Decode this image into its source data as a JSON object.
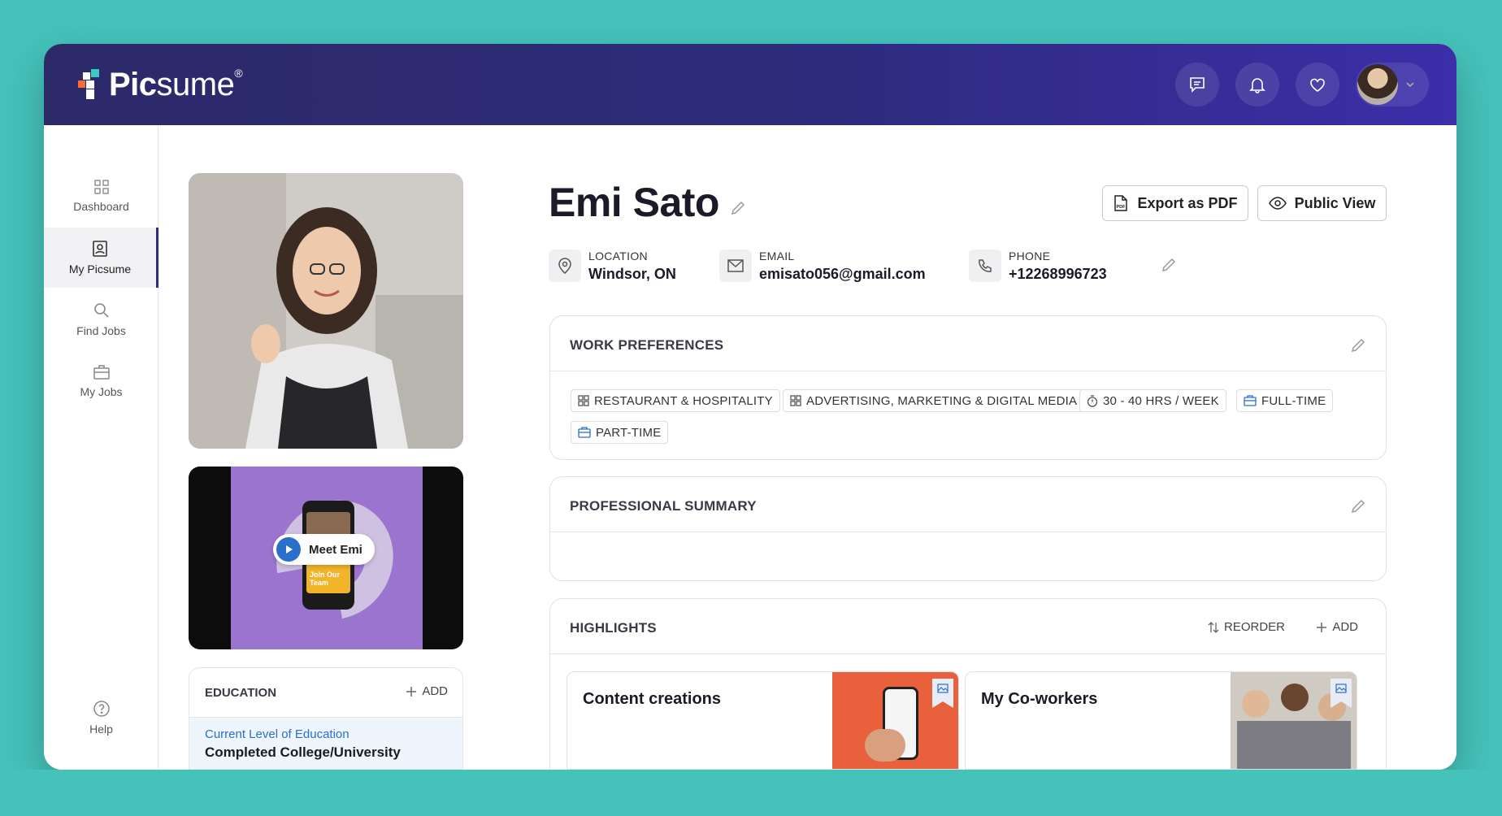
{
  "app": {
    "logo_text_bold": "Pic",
    "logo_text_light": "sume",
    "logo_registered": "®"
  },
  "topbar": {
    "icons": [
      "chat-icon",
      "bell-icon",
      "heart-icon"
    ],
    "avatar": "user-avatar"
  },
  "sidebar": {
    "items": [
      {
        "label": "Dashboard",
        "icon": "grid-icon"
      },
      {
        "label": "My Picsume",
        "icon": "profile-card-icon",
        "active": true
      },
      {
        "label": "Find Jobs",
        "icon": "search-icon"
      },
      {
        "label": "My Jobs",
        "icon": "briefcase-icon"
      }
    ],
    "help_label": "Help"
  },
  "profile": {
    "name": "Emi Sato",
    "export_label": "Export as PDF",
    "public_view_label": "Public View",
    "location_label": "LOCATION",
    "location_value": "Windsor, ON",
    "email_label": "EMAIL",
    "email_value": "emisato056@gmail.com",
    "phone_label": "PHONE",
    "phone_value": "+12268996723"
  },
  "video": {
    "play_label": "Meet Emi",
    "poster_text": "Join Our Team"
  },
  "education": {
    "title": "EDUCATION",
    "add_label": "ADD",
    "level_label": "Current Level of Education",
    "level_value": "Completed College/University"
  },
  "work_preferences": {
    "title": "WORK PREFERENCES",
    "tags": [
      {
        "label": "RESTAURANT & HOSPITALITY",
        "icon": "category-icon"
      },
      {
        "label": "ADVERTISING, MARKETING & DIGITAL MEDIA",
        "icon": "category-icon"
      },
      {
        "label": "30 - 40 HRS / WEEK",
        "icon": "timer-icon"
      },
      {
        "label": "FULL-TIME",
        "icon": "briefcase-icon"
      },
      {
        "label": "PART-TIME",
        "icon": "briefcase-icon"
      }
    ]
  },
  "professional_summary": {
    "title": "PROFESSIONAL SUMMARY"
  },
  "highlights": {
    "title": "HIGHLIGHTS",
    "reorder_label": "REORDER",
    "add_label": "ADD",
    "items": [
      {
        "title": "Content creations"
      },
      {
        "title": "My Co-workers"
      }
    ]
  },
  "colors": {
    "background": "#45c3bb",
    "topbar": "#2e2b7c",
    "accent_blue": "#2a6fc9",
    "logo_orange": "#ff6b35",
    "logo_teal": "#3ec7c0"
  }
}
